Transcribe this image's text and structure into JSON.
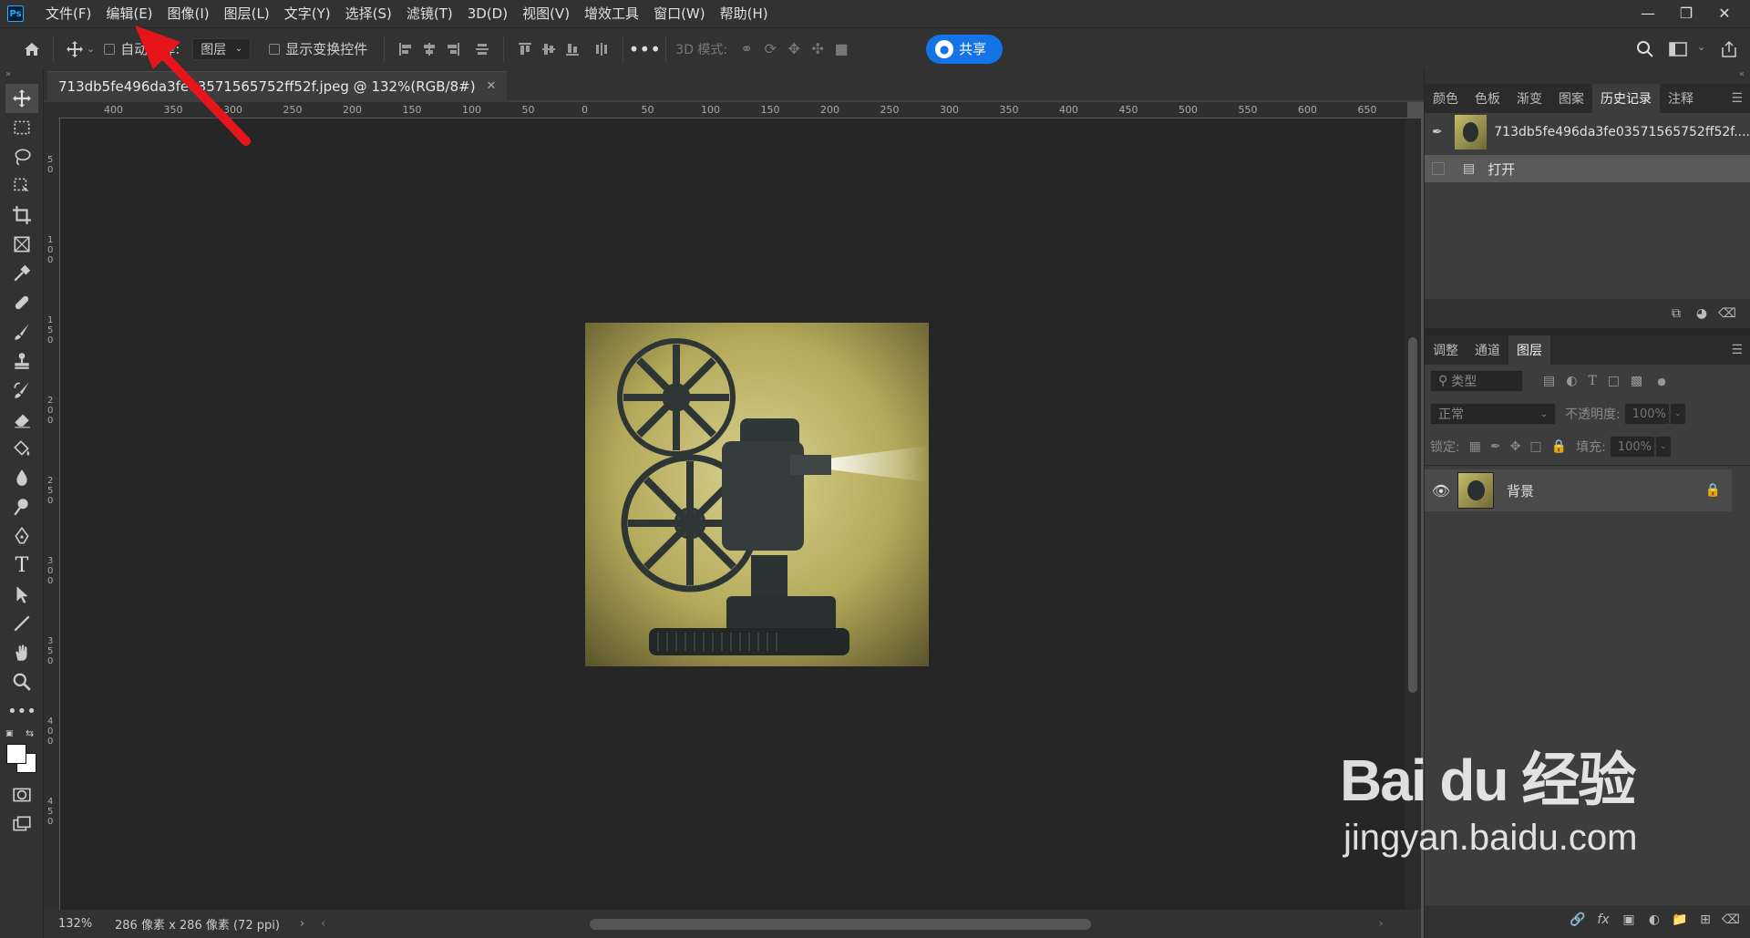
{
  "menubar": {
    "logo": "Ps",
    "items": [
      "文件(F)",
      "编辑(E)",
      "图像(I)",
      "图层(L)",
      "文字(Y)",
      "选择(S)",
      "滤镜(T)",
      "3D(D)",
      "视图(V)",
      "增效工具",
      "窗口(W)",
      "帮助(H)"
    ],
    "window_controls": [
      "minimize-icon",
      "restore-icon",
      "close-icon"
    ]
  },
  "options": {
    "auto_select_label": "自动选择:",
    "auto_select_value": "图层",
    "show_transform_label": "显示变换控件",
    "mode3d_label": "3D 模式:",
    "share_label": "共享"
  },
  "document": {
    "tab_title": "713db5fe496da3fe03571565752ff52f.jpeg @ 132%(RGB/8#)",
    "zoom": "132%",
    "size_info": "286 像素 x 286 像素 (72 ppi)"
  },
  "ruler_h_labels": [
    "400",
    "350",
    "300",
    "250",
    "200",
    "150",
    "100",
    "50",
    "0",
    "50",
    "100",
    "150",
    "200",
    "250",
    "300",
    "350",
    "400",
    "450",
    "500",
    "550",
    "600",
    "650"
  ],
  "ruler_v_labels": [
    "50",
    "100",
    "150",
    "200",
    "250",
    "300",
    "350",
    "400",
    "450"
  ],
  "history_panel": {
    "tabs": [
      "颜色",
      "色板",
      "渐变",
      "图案",
      "历史记录",
      "注释"
    ],
    "active_tab": "历史记录",
    "snapshot_name": "713db5fe496da3fe03571565752ff52f....",
    "states": [
      {
        "label": "打开"
      }
    ]
  },
  "layers_panel": {
    "tabs": [
      "调整",
      "通道",
      "图层"
    ],
    "active_tab": "图层",
    "filter_placeholder": "类型",
    "blend_mode": "正常",
    "opacity_label": "不透明度:",
    "opacity_value": "100%",
    "lock_label": "锁定:",
    "fill_label": "填充:",
    "fill_value": "100%",
    "layers": [
      {
        "name": "背景",
        "locked": true,
        "visible": true
      }
    ]
  },
  "watermark": {
    "brand": "Bai du 经验",
    "url": "jingyan.baidu.com"
  },
  "colors": {
    "accent": "#1473e6",
    "arrow": "#e8141c"
  }
}
